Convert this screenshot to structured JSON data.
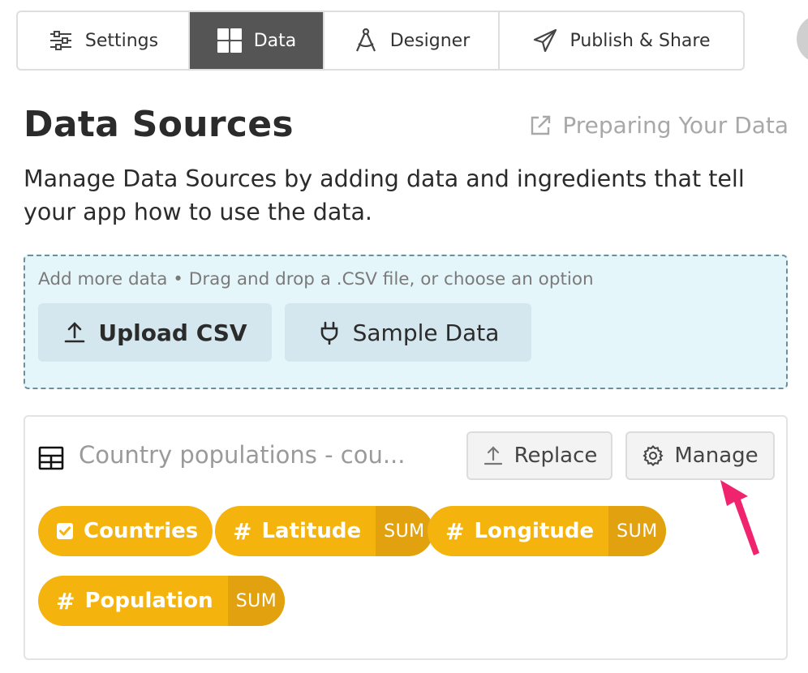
{
  "tabs": [
    {
      "label": "Settings",
      "icon": "sliders-icon",
      "active": false
    },
    {
      "label": "Data",
      "icon": "grid-icon",
      "active": true
    },
    {
      "label": "Designer",
      "icon": "compass-icon",
      "active": false
    },
    {
      "label": "Publish & Share",
      "icon": "paper-plane-icon",
      "active": false
    }
  ],
  "header": {
    "title": "Data Sources",
    "help_link": "Preparing Your Data",
    "subtitle": "Manage Data Sources by adding data and ingredients that tell your app how to use the data."
  },
  "dropzone": {
    "hint": "Add more data • Drag and drop a .CSV file, or choose an option",
    "upload_label": "Upload CSV",
    "sample_label": "Sample Data"
  },
  "source": {
    "name": "Country populations - cou...",
    "replace_label": "Replace",
    "manage_label": "Manage",
    "fields": [
      {
        "label": "Countries",
        "kind": "dimension",
        "aggregation": ""
      },
      {
        "label": "Latitude",
        "kind": "metric",
        "aggregation": "SUM"
      },
      {
        "label": "Longitude",
        "kind": "metric",
        "aggregation": "SUM"
      },
      {
        "label": "Population",
        "kind": "metric",
        "aggregation": "SUM"
      }
    ],
    "hash_symbol": "#"
  },
  "colors": {
    "accent_pill": "#f5b30d",
    "pill_agg": "#e2a210",
    "active_tab": "#555555",
    "dropzone_bg": "#e5f6fb",
    "annotation_arrow": "#f0246e"
  }
}
